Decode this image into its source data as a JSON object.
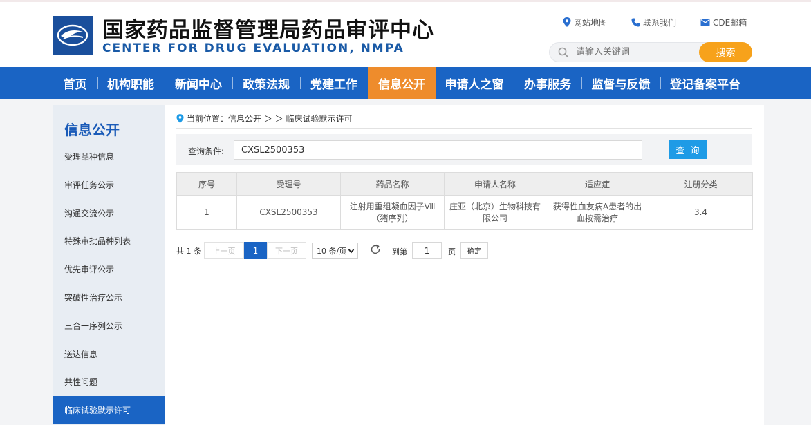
{
  "header": {
    "site_name_cn": "国家药品监督管理局药品审评中心",
    "site_name_en": "CENTER FOR DRUG EVALUATION, NMPA",
    "links": {
      "sitemap": "网站地图",
      "contact": "联系我们",
      "mail": "CDE邮箱"
    },
    "search": {
      "placeholder": "请输入关键词",
      "button": "搜索"
    }
  },
  "nav": {
    "items": [
      {
        "label": "首页"
      },
      {
        "label": "机构职能"
      },
      {
        "label": "新闻中心"
      },
      {
        "label": "政策法规"
      },
      {
        "label": "党建工作"
      },
      {
        "label": "信息公开",
        "active": true
      },
      {
        "label": "申请人之窗"
      },
      {
        "label": "办事服务"
      },
      {
        "label": "监督与反馈"
      },
      {
        "label": "登记备案平台"
      }
    ]
  },
  "sidebar": {
    "title": "信息公开",
    "items": [
      {
        "label": "受理品种信息"
      },
      {
        "label": "审评任务公示"
      },
      {
        "label": "沟通交流公示"
      },
      {
        "label": "特殊审批品种列表"
      },
      {
        "label": "优先审评公示"
      },
      {
        "label": "突破性治疗公示"
      },
      {
        "label": "三合一序列公示"
      },
      {
        "label": "送达信息"
      },
      {
        "label": "共性问题"
      },
      {
        "label": "临床试验默示许可",
        "active": true
      }
    ]
  },
  "breadcrumb": {
    "prefix": "当前位置：",
    "path": "信息公开 ＞ ＞ 临床试验默示许可"
  },
  "query": {
    "label": "查询条件:",
    "value": "CXSL2500353",
    "button": "查 询"
  },
  "table": {
    "headers": [
      "序号",
      "受理号",
      "药品名称",
      "申请人名称",
      "适应症",
      "注册分类"
    ],
    "rows": [
      [
        "1",
        "CXSL2500353",
        "注射用重组凝血因子Ⅷ（猪序列）",
        "庄亚（北京）生物科技有限公司",
        "获得性血友病A患者的出血按需治疗",
        "3.4"
      ]
    ]
  },
  "pagination": {
    "total": "共 1 条",
    "prev": "上一页",
    "current": "1",
    "next": "下一页",
    "page_size": "10 条/页",
    "goto_label": "到第",
    "goto_value": "1",
    "page_suffix": "页",
    "confirm": "确定"
  },
  "colors": {
    "nav_bg": "#1a64c4",
    "nav_active": "#ee8c2c",
    "search_button": "#f7a21b",
    "query_button": "#1e9be6"
  },
  "icons": {
    "logo": "cde-logo",
    "sitemap": "map-pin-icon",
    "contact": "phone-icon",
    "mail": "mail-icon",
    "search": "search-icon",
    "refresh": "refresh-icon"
  }
}
